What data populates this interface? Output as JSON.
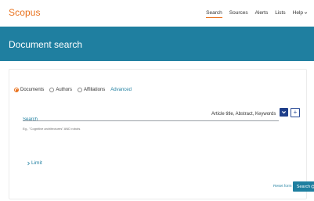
{
  "header": {
    "logo": "Scopus",
    "nav": [
      {
        "label": "Search",
        "active": true
      },
      {
        "label": "Sources",
        "active": false
      },
      {
        "label": "Alerts",
        "active": false
      },
      {
        "label": "Lists",
        "active": false
      },
      {
        "label": "Help",
        "active": false
      }
    ]
  },
  "hero": {
    "title": "Document search"
  },
  "search": {
    "tabs": [
      {
        "label": "Documents",
        "selected": true
      },
      {
        "label": "Authors",
        "selected": false
      },
      {
        "label": "Affiliations",
        "selected": false
      }
    ],
    "advanced_label": "Advanced",
    "input_value": "",
    "input_placeholder": "Search",
    "example_text": "Eg., \"Cognitive architectures\" AND robots",
    "field_select": "Article title, Abstract, Keywords",
    "add_field_symbol": "+",
    "limit_label": "Limit",
    "reset_label": "Reset form",
    "search_button_label": "Search"
  },
  "colors": {
    "accent_orange": "#e9711c",
    "brand_blue": "#1f7fa0",
    "dark_blue": "#1f3f8a"
  },
  "icons": {
    "help_dropdown": "chevron-down-icon",
    "field_dropdown": "chevron-down-icon",
    "limit": "chevron-right-icon",
    "search": "search-icon"
  }
}
